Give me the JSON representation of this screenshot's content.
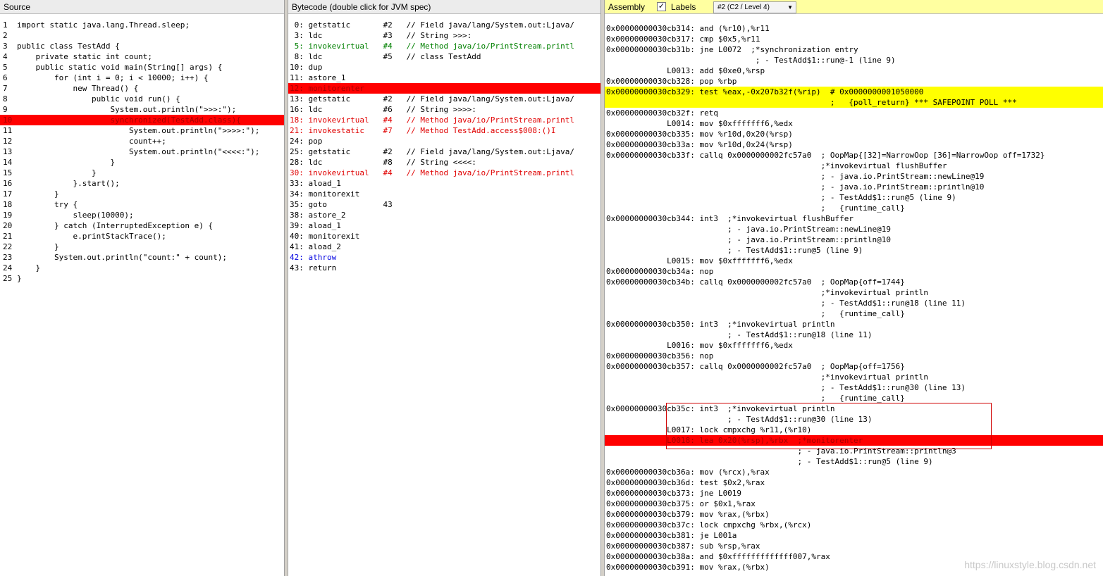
{
  "source": {
    "title": "Source",
    "lines": [
      {
        "n": "1",
        "t": "import static java.lang.Thread.sleep;"
      },
      {
        "n": "2",
        "t": ""
      },
      {
        "n": "3",
        "t": "public class TestAdd {"
      },
      {
        "n": "4",
        "t": "    private static int count;"
      },
      {
        "n": "5",
        "t": "    public static void main(String[] args) {"
      },
      {
        "n": "6",
        "t": "        for (int i = 0; i < 10000; i++) {"
      },
      {
        "n": "7",
        "t": "            new Thread() {"
      },
      {
        "n": "8",
        "t": "                public void run() {"
      },
      {
        "n": "9",
        "t": "                    System.out.println(\">>>:\");"
      },
      {
        "n": "10",
        "t": "                    synchronized(TestAdd.class){",
        "hl": "red"
      },
      {
        "n": "11",
        "t": "                        System.out.println(\">>>>:\");"
      },
      {
        "n": "12",
        "t": "                        count++;"
      },
      {
        "n": "13",
        "t": "                        System.out.println(\"<<<<:\");"
      },
      {
        "n": "14",
        "t": "                    }"
      },
      {
        "n": "15",
        "t": "                }"
      },
      {
        "n": "16",
        "t": "            }.start();"
      },
      {
        "n": "17",
        "t": "        }"
      },
      {
        "n": "18",
        "t": "        try {"
      },
      {
        "n": "19",
        "t": "            sleep(10000);"
      },
      {
        "n": "20",
        "t": "        } catch (InterruptedException e) {"
      },
      {
        "n": "21",
        "t": "            e.printStackTrace();"
      },
      {
        "n": "22",
        "t": "        }"
      },
      {
        "n": "23",
        "t": "        System.out.println(\"count:\" + count);"
      },
      {
        "n": "24",
        "t": "    }"
      },
      {
        "n": "25",
        "t": "}"
      }
    ]
  },
  "bytecode": {
    "title": "Bytecode (double click for JVM spec)",
    "lines": [
      {
        "t": " 0: getstatic       #2   // Field java/lang/System.out:Ljava/"
      },
      {
        "t": " 3: ldc             #3   // String >>>:"
      },
      {
        "t": " 5: invokevirtual   #4   // Method java/io/PrintStream.printl",
        "color": "green"
      },
      {
        "t": " 8: ldc             #5   // class TestAdd"
      },
      {
        "t": "10: dup"
      },
      {
        "t": "11: astore_1"
      },
      {
        "t": "12: monitorenter",
        "hl": "red"
      },
      {
        "t": "13: getstatic       #2   // Field java/lang/System.out:Ljava/"
      },
      {
        "t": "16: ldc             #6   // String >>>>:"
      },
      {
        "t": "18: invokevirtual   #4   // Method java/io/PrintStream.printl",
        "color": "red"
      },
      {
        "t": "21: invokestatic    #7   // Method TestAdd.access$008:()I",
        "color": "red"
      },
      {
        "t": "24: pop"
      },
      {
        "t": "25: getstatic       #2   // Field java/lang/System.out:Ljava/"
      },
      {
        "t": "28: ldc             #8   // String <<<<:"
      },
      {
        "t": "30: invokevirtual   #4   // Method java/io/PrintStream.printl",
        "color": "red"
      },
      {
        "t": "33: aload_1"
      },
      {
        "t": "34: monitorexit"
      },
      {
        "t": "35: goto            43"
      },
      {
        "t": "38: astore_2"
      },
      {
        "t": "39: aload_1"
      },
      {
        "t": "40: monitorexit"
      },
      {
        "t": "41: aload_2"
      },
      {
        "t": "42: athrow",
        "color": "blue"
      },
      {
        "t": "43: return"
      }
    ]
  },
  "assembly": {
    "title": "Assembly",
    "labels_checkbox": "Labels",
    "labels_checked": true,
    "level_select": "#2  (C2 / Level 4)",
    "lines": [
      {
        "t": "0x00000000030cb314: and (%r10),%r11"
      },
      {
        "t": "0x00000000030cb317: cmp $0x5,%r11"
      },
      {
        "t": "0x00000000030cb31b: jne L0072  ;*synchronization entry"
      },
      {
        "t": "                                ; - TestAdd$1::run@-1 (line 9)"
      },
      {
        "t": "             L0013: add $0xe0,%rsp"
      },
      {
        "t": "0x00000000030cb328: pop %rbp"
      },
      {
        "t": "0x00000000030cb329: test %eax,-0x207b32f(%rip)  # 0x0000000001050000",
        "hl": "yellow"
      },
      {
        "t": "                                                ;   {poll_return} *** SAFEPOINT POLL ***",
        "hl": "yellow"
      },
      {
        "t": "0x00000000030cb32f: retq"
      },
      {
        "t": "             L0014: mov $0xfffffff6,%edx"
      },
      {
        "t": "0x00000000030cb335: mov %r10d,0x20(%rsp)"
      },
      {
        "t": "0x00000000030cb33a: mov %r10d,0x24(%rsp)"
      },
      {
        "t": "0x00000000030cb33f: callq 0x0000000002fc57a0  ; OopMap{[32]=NarrowOop [36]=NarrowOop off=1732}"
      },
      {
        "t": "                                              ;*invokevirtual flushBuffer"
      },
      {
        "t": "                                              ; - java.io.PrintStream::newLine@19"
      },
      {
        "t": "                                              ; - java.io.PrintStream::println@10"
      },
      {
        "t": "                                              ; - TestAdd$1::run@5 (line 9)"
      },
      {
        "t": "                                              ;   {runtime_call}"
      },
      {
        "t": "0x00000000030cb344: int3  ;*invokevirtual flushBuffer"
      },
      {
        "t": "                          ; - java.io.PrintStream::newLine@19"
      },
      {
        "t": "                          ; - java.io.PrintStream::println@10"
      },
      {
        "t": "                          ; - TestAdd$1::run@5 (line 9)"
      },
      {
        "t": "             L0015: mov $0xfffffff6,%edx"
      },
      {
        "t": "0x00000000030cb34a: nop"
      },
      {
        "t": "0x00000000030cb34b: callq 0x0000000002fc57a0  ; OopMap{off=1744}"
      },
      {
        "t": "                                              ;*invokevirtual println"
      },
      {
        "t": "                                              ; - TestAdd$1::run@18 (line 11)"
      },
      {
        "t": "                                              ;   {runtime_call}"
      },
      {
        "t": "0x00000000030cb350: int3  ;*invokevirtual println"
      },
      {
        "t": "                          ; - TestAdd$1::run@18 (line 11)"
      },
      {
        "t": "             L0016: mov $0xfffffff6,%edx"
      },
      {
        "t": "0x00000000030cb356: nop"
      },
      {
        "t": "0x00000000030cb357: callq 0x0000000002fc57a0  ; OopMap{off=1756}"
      },
      {
        "t": "                                              ;*invokevirtual println"
      },
      {
        "t": "                                              ; - TestAdd$1::run@30 (line 13)"
      },
      {
        "t": "                                              ;   {runtime_call}"
      },
      {
        "t": "0x00000000030cb35c: int3  ;*invokevirtual println"
      },
      {
        "t": "                          ; - TestAdd$1::run@30 (line 13)"
      },
      {
        "t": "             L0017: lock cmpxchg %r11,(%r10)"
      },
      {
        "t": "             L0018: lea 0x20(%rsp),%rbx  ;*monitorenter",
        "hl": "red"
      },
      {
        "t": "                                         ; - java.io.PrintStream::println@3"
      },
      {
        "t": "                                         ; - TestAdd$1::run@5 (line 9)"
      },
      {
        "t": "0x00000000030cb36a: mov (%rcx),%rax"
      },
      {
        "t": "0x00000000030cb36d: test $0x2,%rax"
      },
      {
        "t": "0x00000000030cb373: jne L0019"
      },
      {
        "t": "0x00000000030cb375: or $0x1,%rax"
      },
      {
        "t": "0x00000000030cb379: mov %rax,(%rbx)"
      },
      {
        "t": "0x00000000030cb37c: lock cmpxchg %rbx,(%rcx)"
      },
      {
        "t": "0x00000000030cb381: je L001a"
      },
      {
        "t": "0x00000000030cb387: sub %rsp,%rax"
      },
      {
        "t": "0x00000000030cb38a: and $0xfffffffffffff007,%rax"
      },
      {
        "t": "0x00000000030cb391: mov %rax,(%rbx)"
      }
    ]
  },
  "watermark": "https://linuxstyle.blog.csdn.net"
}
